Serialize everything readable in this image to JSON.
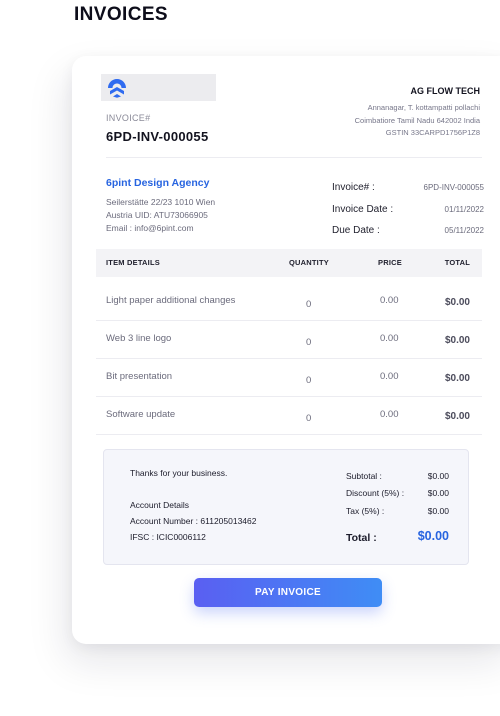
{
  "page": {
    "title": "INVOICES"
  },
  "invoice": {
    "number_label": "INVOICE#",
    "number": "6PD-INV-000055"
  },
  "company": {
    "name": "AG FLOW TECH",
    "address_lines": [
      "Annanagar, T. kottampatti pollachi",
      "Coimbatiore Tamil Nadu 642002 India",
      "GSTIN 33CARPD1756P1Z8"
    ]
  },
  "client": {
    "name": "6pint Design Agency",
    "lines": [
      "Seilerstätte 22/23 1010 Wien",
      "Austria UID: ATU73066905",
      "Email : info@6pint.com"
    ]
  },
  "meta": [
    {
      "key": "Invoice#  :",
      "value": "6PD-INV-000055"
    },
    {
      "key": "Invoice Date  :",
      "value": "01/11/2022"
    },
    {
      "key": "Due Date  :",
      "value": "05/11/2022"
    }
  ],
  "table": {
    "headers": {
      "item": "ITEM DETAILS",
      "quantity": "QUANTITY",
      "price": "PRICE",
      "total": "TOTAL"
    },
    "rows": [
      {
        "description": "Light paper additional changes",
        "quantity": "0",
        "price": "0.00",
        "total": "$0.00"
      },
      {
        "description": "Web 3 line logo",
        "quantity": "0",
        "price": "0.00",
        "total": "$0.00"
      },
      {
        "description": "Bit presentation",
        "quantity": "0",
        "price": "0.00",
        "total": "$0.00"
      },
      {
        "description": "Software update",
        "quantity": "0",
        "price": "0.00",
        "total": "$0.00"
      }
    ]
  },
  "summary": {
    "thanks": "Thanks for your business.",
    "account_title": "Account Details",
    "account_number": "Account Number : 611205013462",
    "ifsc": "IFSC : ICIC0006112",
    "subtotal_label": "Subtotal  :",
    "subtotal": "$0.00",
    "discount_label": "Discount (5%)  :",
    "discount": "$0.00",
    "tax_label": "Tax (5%)  :",
    "tax": "$0.00",
    "total_label": "Total  :",
    "total": "$0.00"
  },
  "actions": {
    "pay_label": "PAY INVOICE"
  },
  "colors": {
    "accent": "#2764e0",
    "button_start": "#5a5ff2",
    "button_end": "#3f8df5"
  },
  "icons": {
    "logo": "brand-logo-icon"
  }
}
